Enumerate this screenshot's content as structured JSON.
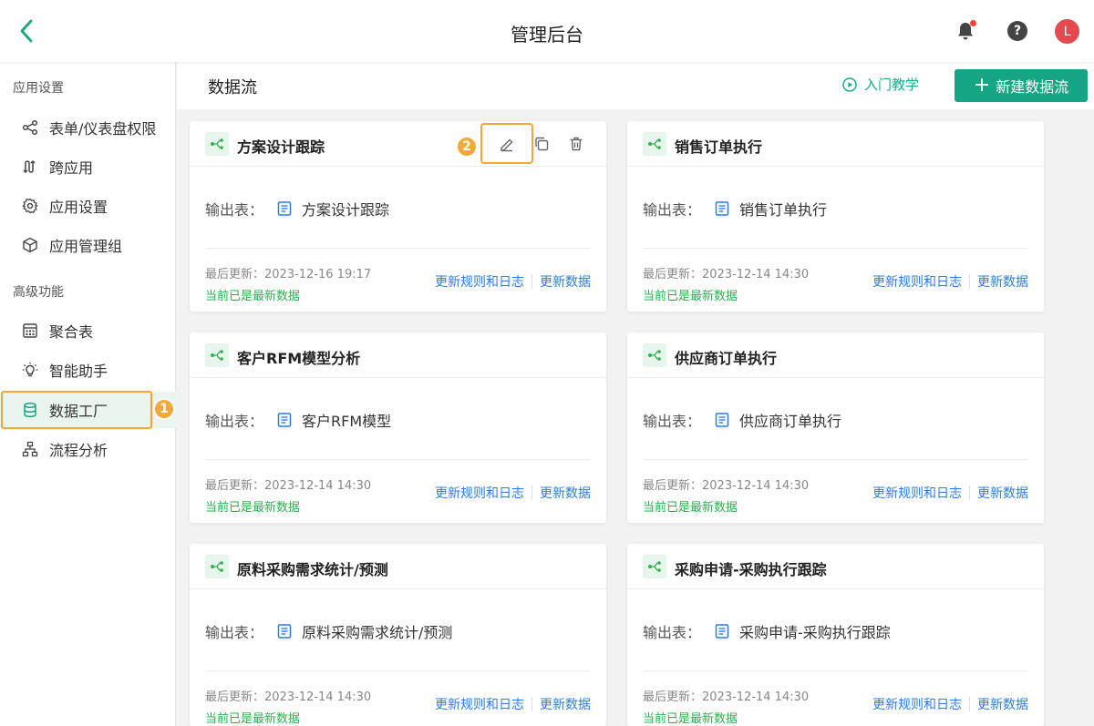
{
  "header": {
    "title": "管理后台",
    "avatar_letter": "L"
  },
  "sidebar": {
    "sections": [
      {
        "label": "应用设置"
      },
      {
        "label": "高级功能"
      }
    ],
    "items": [
      {
        "label": "表单/仪表盘权限",
        "icon": "share-icon"
      },
      {
        "label": "跨应用",
        "icon": "cross-app-icon"
      },
      {
        "label": "应用设置",
        "icon": "gear-icon"
      },
      {
        "label": "应用管理组",
        "icon": "cube-icon"
      },
      {
        "label": "聚合表",
        "icon": "aggregate-table-icon"
      },
      {
        "label": "智能助手",
        "icon": "lightbulb-icon"
      },
      {
        "label": "数据工厂",
        "icon": "database-icon",
        "active": true
      },
      {
        "label": "流程分析",
        "icon": "flowchart-icon"
      }
    ]
  },
  "main": {
    "title": "数据流",
    "tutorial_label": "入门教学",
    "new_button_label": "新建数据流"
  },
  "annotations": {
    "badge1": "1",
    "badge2": "2"
  },
  "cards": [
    {
      "title": "方案设计跟踪",
      "output_label": "输出表：",
      "output_table": "方案设计跟踪",
      "updated": "最后更新：2023-12-16 19:17",
      "status": "当前已是最新数据",
      "link_rules": "更新规则和日志",
      "link_update": "更新数据"
    },
    {
      "title": "销售订单执行",
      "output_label": "输出表：",
      "output_table": "销售订单执行",
      "updated": "最后更新：2023-12-14 14:30",
      "status": "当前已是最新数据",
      "link_rules": "更新规则和日志",
      "link_update": "更新数据"
    },
    {
      "title": "客户RFM模型分析",
      "output_label": "输出表：",
      "output_table": "客户RFM模型",
      "updated": "最后更新：2023-12-14 14:30",
      "status": "当前已是最新数据",
      "link_rules": "更新规则和日志",
      "link_update": "更新数据"
    },
    {
      "title": "供应商订单执行",
      "output_label": "输出表：",
      "output_table": "供应商订单执行",
      "updated": "最后更新：2023-12-14 14:30",
      "status": "当前已是最新数据",
      "link_rules": "更新规则和日志",
      "link_update": "更新数据"
    },
    {
      "title": "原料采购需求统计/预测",
      "output_label": "输出表：",
      "output_table": "原料采购需求统计/预测",
      "updated": "最后更新：2023-12-14 14:30",
      "status": "当前已是最新数据",
      "link_rules": "更新规则和日志",
      "link_update": "更新数据"
    },
    {
      "title": "采购申请-采购执行跟踪",
      "output_label": "输出表：",
      "output_table": "采购申请-采购执行跟踪",
      "updated": "最后更新：2023-12-14 14:30",
      "status": "当前已是最新数据",
      "link_rules": "更新规则和日志",
      "link_update": "更新数据"
    }
  ],
  "colors": {
    "accent": "#17a683",
    "link": "#2b7de9",
    "status_ok": "#2bb24c",
    "highlight": "#f0a93b"
  }
}
